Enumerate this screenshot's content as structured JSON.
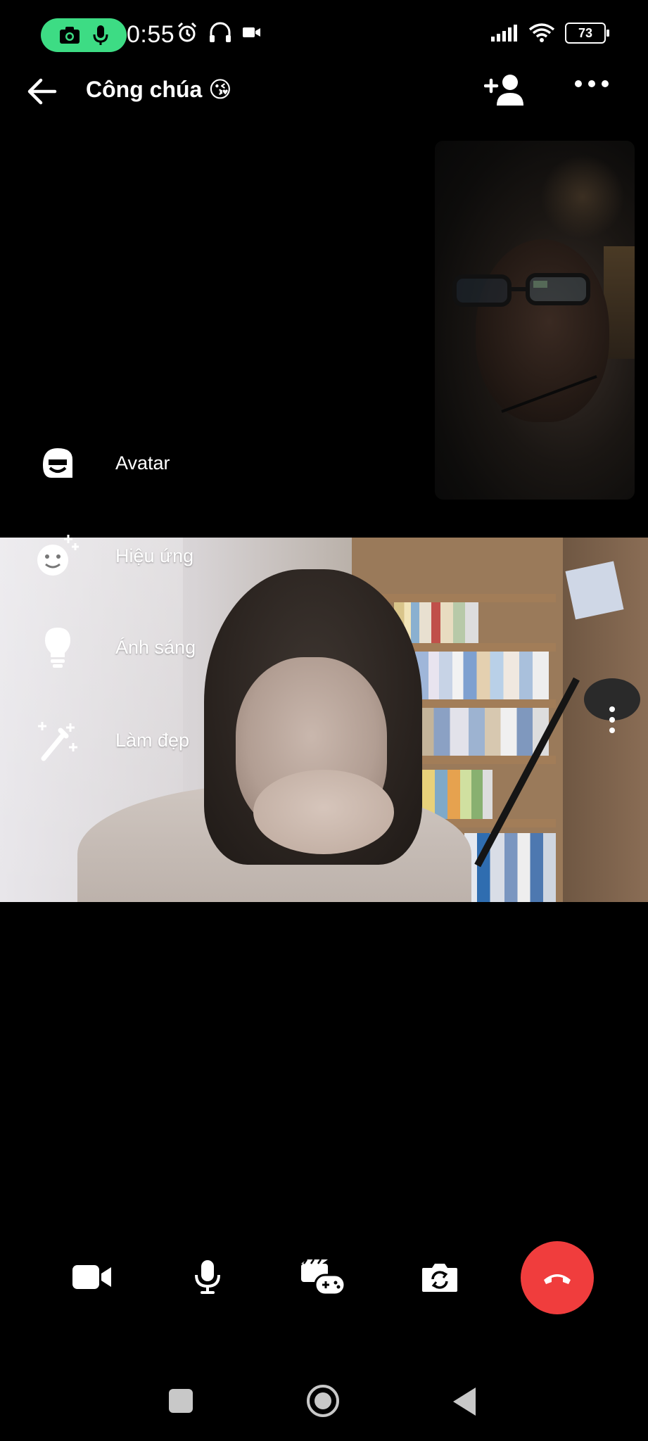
{
  "status_bar": {
    "time": "0:55",
    "battery": "73",
    "pill_icons": [
      "camera-icon",
      "microphone-icon"
    ],
    "left_icons": [
      "alarm-icon",
      "headphones-icon",
      "video-record-icon"
    ],
    "right_icons": [
      "signal-icon",
      "wifi-icon",
      "battery-icon"
    ],
    "pill_color": "#3ddc84"
  },
  "header": {
    "title": "Công chúa 😘",
    "back_icon": "arrow-left-icon",
    "add_person_icon": "add-person-icon",
    "more_icon": "more-horizontal-icon"
  },
  "effects_menu": {
    "items": [
      {
        "label": "Avatar",
        "icon": "avatar-icon"
      },
      {
        "label": "Hiệu ứng",
        "icon": "sparkle-smiley-icon"
      },
      {
        "label": "Ánh sáng",
        "icon": "lightbulb-icon"
      },
      {
        "label": "Làm đẹp",
        "icon": "magic-wand-icon"
      }
    ]
  },
  "controls": {
    "items": [
      "video-camera-icon",
      "microphone-icon",
      "games-icon",
      "flip-camera-icon",
      "end-call-icon"
    ],
    "end_call_color": "#f03d3d"
  },
  "nav_bar": {
    "items": [
      "recent-apps-icon",
      "home-icon",
      "back-icon"
    ]
  }
}
